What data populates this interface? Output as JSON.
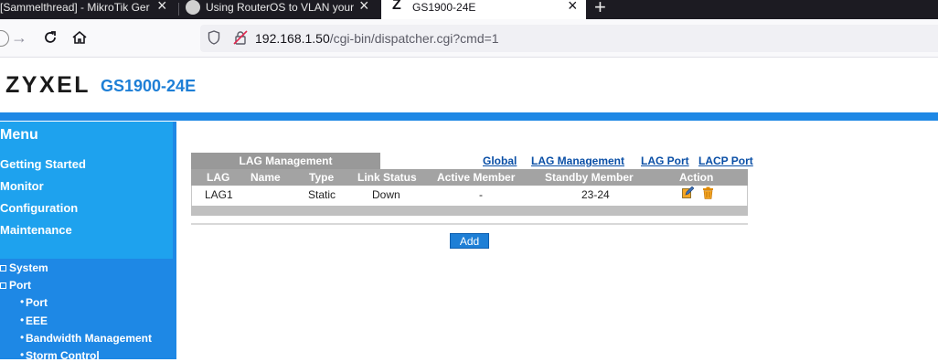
{
  "browser": {
    "tabs": [
      {
        "title": "[Sammelthread] - MikroTik Ger"
      },
      {
        "title": "Using RouterOS to VLAN your n"
      },
      {
        "title": "GS1900-24E",
        "favicon": "Z"
      }
    ],
    "url_host": "192.168.1.50",
    "url_path": "/cgi-bin/dispatcher.cgi?cmd=1"
  },
  "header": {
    "logo": "ZYXEL",
    "model": "GS1900-24E"
  },
  "menu": {
    "title": "Menu",
    "items": [
      "Getting Started",
      "Monitor",
      "Configuration",
      "Maintenance"
    ],
    "tree": [
      {
        "label": "System"
      },
      {
        "label": "Port"
      },
      {
        "label": "Port"
      },
      {
        "label": "EEE"
      },
      {
        "label": "Bandwidth Management"
      },
      {
        "label": "Storm Control"
      }
    ]
  },
  "lag": {
    "tab_label": "LAG Management",
    "links": [
      "Global",
      "LAG Management",
      "LAG Port",
      "LACP Port"
    ],
    "columns": [
      "LAG",
      "Name",
      "Type",
      "Link Status",
      "Active Member",
      "Standby Member",
      "Action"
    ],
    "rows": [
      {
        "lag": "LAG1",
        "name": "",
        "type": "Static",
        "link_status": "Down",
        "active_member": "-",
        "standby_member": "23-24"
      }
    ],
    "add_label": "Add"
  },
  "colors": {
    "accent": "#1e88e5",
    "menu_bg": "#1ea2ee",
    "model_text": "#1e7fd6",
    "link": "#0a4fa6"
  }
}
